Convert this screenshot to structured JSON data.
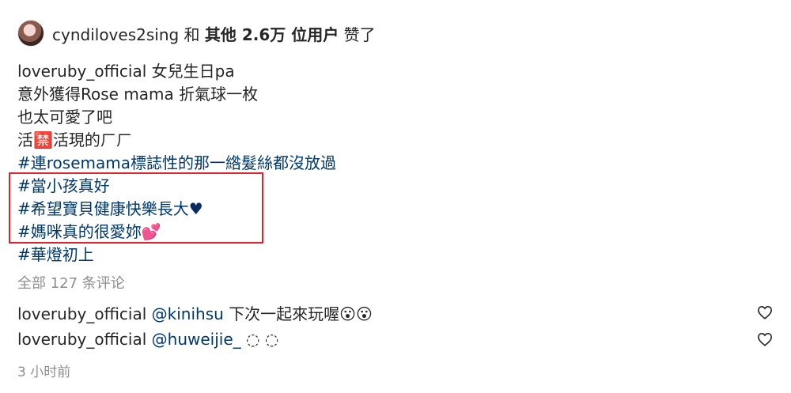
{
  "likes": {
    "username": "cyndiloves2sing",
    "text_and": "和",
    "text_others": "其他 2.6万 位用户",
    "text_liked": "赞了"
  },
  "caption": {
    "username": "loveruby_official",
    "first_text": "女兒生日pa",
    "lines": [
      "意外獲得Rose mama 折氣球一枚",
      "也太可愛了吧",
      "活🈲活現的ㄏㄏ"
    ],
    "hashtag_line_1": "#連rosemama標誌性的那一綹髮絲都沒放過",
    "hashtag_highlight_1": "#當小孩真好",
    "hashtag_highlight_2": "#希望寶貝健康快樂長大",
    "hashtag_highlight_2_emoji": "♥",
    "hashtag_highlight_3": "#媽咪真的很愛妳",
    "hashtag_highlight_3_emoji": "💕",
    "hashtag_last": "#華燈初上"
  },
  "comments_link": "全部 127 条评论",
  "comments": [
    {
      "username": "loveruby_official",
      "mention": "@kinihsu",
      "text": "下次一起來玩喔😮😮"
    },
    {
      "username": "loveruby_official",
      "mention": "@huweijie_",
      "text": "◌ ◌"
    }
  ],
  "timestamp": "3 小时前",
  "colors": {
    "hashtag": "#00376b",
    "highlight_border": "#e0232e",
    "muted": "#8e8e8e"
  }
}
